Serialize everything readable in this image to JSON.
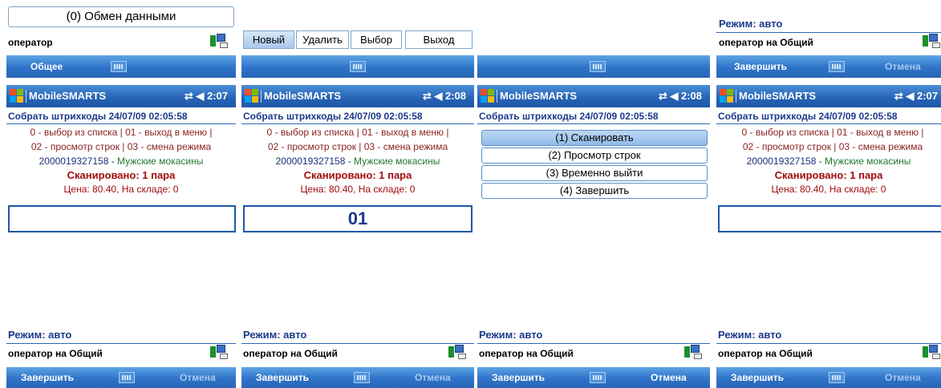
{
  "top": {
    "exchange_button": "(0) Обмен данными",
    "operator_short": "оператор",
    "operator_full": "оператор на Общий",
    "mode_label": "Режим: авто",
    "softkey_general": "Общее",
    "softkey_finish": "Завершить",
    "softkey_cancel": "Отмена",
    "toolbar": [
      "Новый",
      "Удалить",
      "Выбор",
      "Выход"
    ]
  },
  "screens": [
    {
      "app": "MobileSMARTS",
      "time": "2:07"
    },
    {
      "app": "MobileSMARTS",
      "time": "2:08"
    },
    {
      "app": "MobileSMARTS",
      "time": "2:08"
    },
    {
      "app": "MobileSMARTS",
      "time": "2:07"
    }
  ],
  "doc": {
    "title": "Собрать штрихкоды 24/07/09 02:05:58",
    "help_line1": "0 - выбор из списка | 01 - выход в меню |",
    "help_line2": "02 - просмотр строк | 03 - смена режима",
    "barcode": "2000019327158 -",
    "product": "Мужские мокасины",
    "scanned": "Сканировано: 1 пара",
    "price": "Цена: 80.40, На складе: 0",
    "input_value": "01"
  },
  "menu": [
    "(1) Сканировать",
    "(2) Просмотр строк",
    "(3) Временно выйти",
    "(4) Завершить"
  ],
  "bottom": {
    "mode_label": "Режим: авто",
    "operator": "оператор на Общий",
    "finish": "Завершить",
    "cancel": "Отмена"
  }
}
